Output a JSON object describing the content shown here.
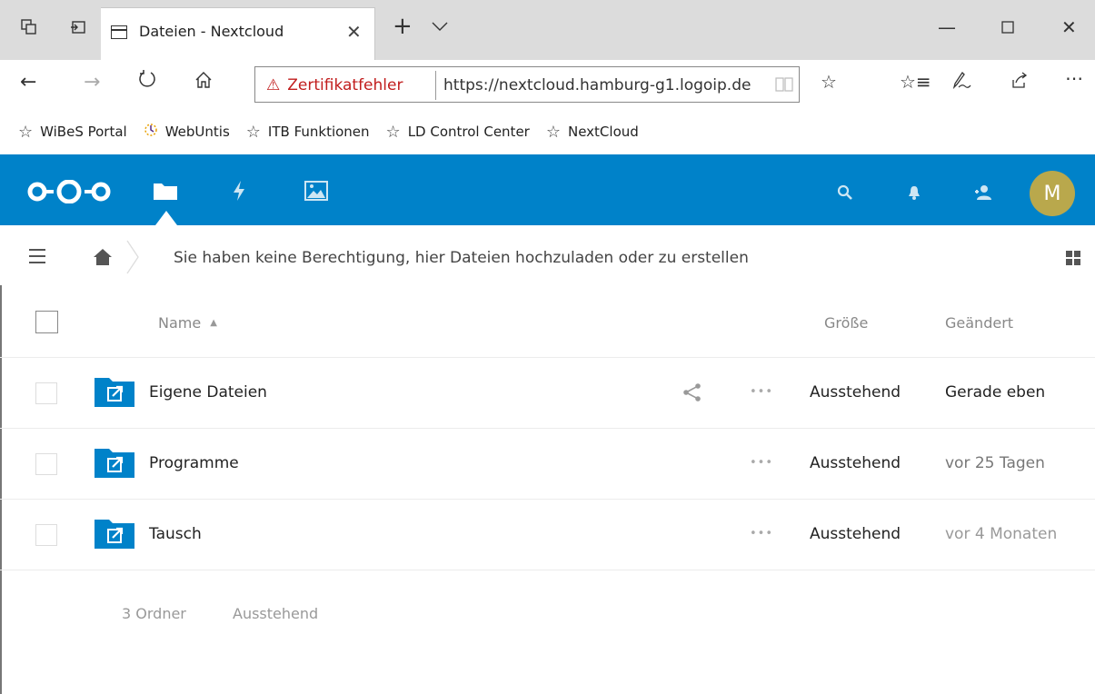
{
  "browser": {
    "tab_title": "Dateien - Nextcloud",
    "cert_warning": "Zertifikatfehler",
    "url": "https://nextcloud.hamburg-g1.logoip.de",
    "favorites": [
      {
        "label": "WiBeS Portal",
        "icon": "star-icon"
      },
      {
        "label": "WebUntis",
        "icon": "webuntis-icon"
      },
      {
        "label": "ITB Funktionen",
        "icon": "star-icon"
      },
      {
        "label": "LD Control Center",
        "icon": "star-icon"
      },
      {
        "label": "NextCloud",
        "icon": "star-icon"
      }
    ]
  },
  "header": {
    "accent": "#0082c9",
    "apps": [
      "files-icon",
      "activity-icon",
      "gallery-icon"
    ],
    "avatar_initial": "M",
    "avatar_color": "#b9a84c"
  },
  "breadcrumb": {
    "message": "Sie haben keine Berechtigung, hier Dateien hochzuladen oder zu erstellen"
  },
  "table": {
    "columns": {
      "name": "Name",
      "size": "Größe",
      "modified": "Geändert"
    },
    "rows": [
      {
        "name": "Eigene Dateien",
        "size": "Ausstehend",
        "modified": "Gerade eben",
        "shareable": true
      },
      {
        "name": "Programme",
        "size": "Ausstehend",
        "modified": "vor 25 Tagen",
        "shareable": false
      },
      {
        "name": "Tausch",
        "size": "Ausstehend",
        "modified": "vor 4 Monaten",
        "shareable": false
      }
    ],
    "summary": {
      "count": "3 Ordner",
      "size": "Ausstehend"
    }
  }
}
